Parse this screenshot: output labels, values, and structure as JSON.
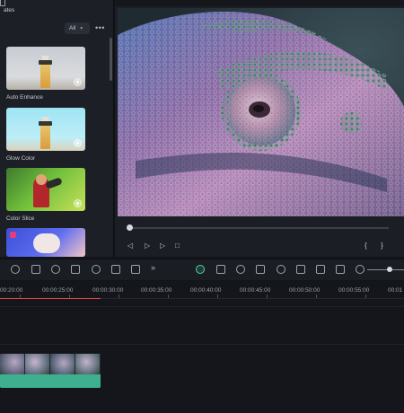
{
  "templates_panel": {
    "title": "ates",
    "filter": {
      "value": "All"
    },
    "more_label": "•••",
    "cards": [
      {
        "label": "Auto Enhance"
      },
      {
        "label": "Glow Color"
      },
      {
        "label": "Color Slice"
      },
      {
        "label": ""
      }
    ]
  },
  "preview": {
    "controls": {
      "prev": "◁",
      "play_step": "▷",
      "play": "▷",
      "stop": "□",
      "mark_in": "{",
      "mark_out": "}"
    },
    "playback_progress": 0.0
  },
  "toolbar": {
    "more_label": "»",
    "icons": [
      "undo-icon",
      "crop-icon",
      "speed-icon",
      "zoom-icon",
      "color-icon",
      "adjust-icon",
      "ai-icon",
      "ai-assist-icon",
      "snapshot-icon",
      "render-icon",
      "shield-icon",
      "mic-icon",
      "list-icon",
      "replace-icon",
      "export-icon",
      "zoom-out-icon"
    ],
    "zoom_level": 0.55
  },
  "timeline": {
    "ruler": [
      "00:20:00",
      "00:00:25:00",
      "00:00:30:00",
      "00:00:35:00",
      "00:00:40:00",
      "00:00:45:00",
      "00:00:50:00",
      "00:00:55:00",
      "00:01"
    ],
    "colors": {
      "playhead": "#e0494a",
      "clip": "#3fb08f",
      "accent": "#49d7a2"
    }
  }
}
